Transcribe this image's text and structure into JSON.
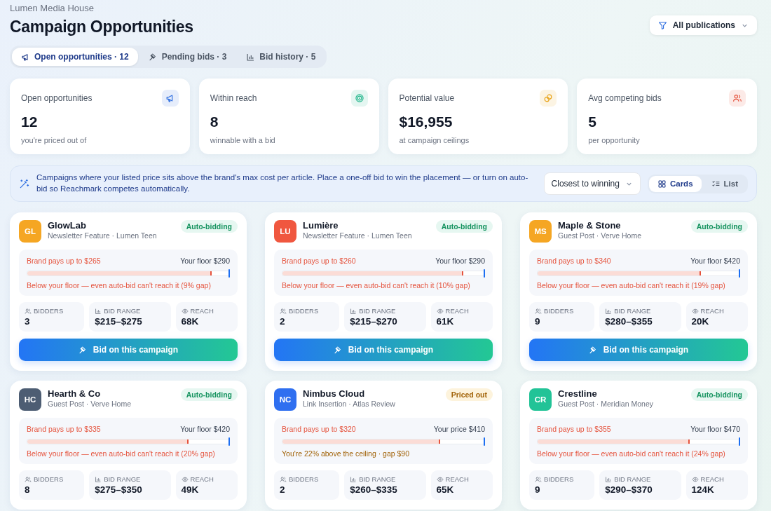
{
  "org": "Lumen Media House",
  "title": "Campaign Opportunities",
  "filter": {
    "label": "All publications"
  },
  "tabs": [
    {
      "label": "Open opportunities · 12",
      "kind": "megaphone",
      "selected": true
    },
    {
      "label": "Pending bids · 3",
      "kind": "gavel",
      "selected": false
    },
    {
      "label": "Bid history · 5",
      "kind": "chart",
      "selected": false
    }
  ],
  "stats": [
    {
      "label": "Open opportunities",
      "value": "12",
      "note": "you're priced out of",
      "kind": "megaphone",
      "color": "#2f6fe0"
    },
    {
      "label": "Within reach",
      "value": "8",
      "note": "winnable with a bid",
      "kind": "target",
      "color": "#1fb58a"
    },
    {
      "label": "Potential value",
      "value": "$16,955",
      "note": "at campaign ceilings",
      "kind": "coins",
      "color": "#e8a317"
    },
    {
      "label": "Avg competing bids",
      "value": "5",
      "note": "per opportunity",
      "kind": "users",
      "color": "#e5533d"
    }
  ],
  "banner": {
    "text": "Campaigns where your listed price sits above the brand's max cost per article. Place a one-off bid to win the placement — or turn on auto-bid so Reachmark competes automatically.",
    "sort": "Closest to winning",
    "views": [
      {
        "label": "Cards",
        "kind": "grid",
        "selected": true
      },
      {
        "label": "List",
        "kind": "list",
        "selected": false
      }
    ]
  },
  "campaigns": [
    {
      "initials": "GL",
      "color": "#f5a623",
      "name": "GlowLab",
      "sub": "Newsletter Feature · Lumen Teen",
      "status": {
        "kind": "auto",
        "label": "Auto-bidding"
      },
      "brand": "Brand pays up to $265",
      "floor": "Your floor $290",
      "level": 0.914,
      "note": "Below your floor — even auto-bid can't reach it (9% gap)",
      "metrics": [
        {
          "kind": "bidders",
          "label": "BIDDERS",
          "value": "3"
        },
        {
          "kind": "range",
          "label": "BID RANGE",
          "value": "$215–$275"
        },
        {
          "kind": "reach",
          "label": "REACH",
          "value": "68K"
        }
      ],
      "button": "Bid on this campaign"
    },
    {
      "initials": "LU",
      "color": "#f0573f",
      "name": "Lumière",
      "sub": "Newsletter Feature · Lumen Teen",
      "status": {
        "kind": "auto",
        "label": "Auto-bidding"
      },
      "brand": "Brand pays up to $260",
      "floor": "Your floor $290",
      "level": 0.897,
      "note": "Below your floor — even auto-bid can't reach it (10% gap)",
      "metrics": [
        {
          "kind": "bidders",
          "label": "BIDDERS",
          "value": "2"
        },
        {
          "kind": "range",
          "label": "BID RANGE",
          "value": "$215–$270"
        },
        {
          "kind": "reach",
          "label": "REACH",
          "value": "61K"
        }
      ],
      "button": "Bid on this campaign"
    },
    {
      "initials": "MS",
      "color": "#f5a623",
      "name": "Maple & Stone",
      "sub": "Guest Post · Verve Home",
      "status": {
        "kind": "auto",
        "label": "Auto-bidding"
      },
      "brand": "Brand pays up to $340",
      "floor": "Your floor $420",
      "level": 0.81,
      "note": "Below your floor — even auto-bid can't reach it (19% gap)",
      "metrics": [
        {
          "kind": "bidders",
          "label": "BIDDERS",
          "value": "9"
        },
        {
          "kind": "range",
          "label": "BID RANGE",
          "value": "$280–$355"
        },
        {
          "kind": "reach",
          "label": "REACH",
          "value": "20K"
        }
      ],
      "button": "Bid on this campaign"
    },
    {
      "initials": "HC",
      "color": "#4d5d73",
      "name": "Hearth & Co",
      "sub": "Guest Post · Verve Home",
      "status": {
        "kind": "auto",
        "label": "Auto-bidding"
      },
      "brand": "Brand pays up to $335",
      "floor": "Your floor $420",
      "level": 0.798,
      "note": "Below your floor — even auto-bid can't reach it (20% gap)",
      "metrics": [
        {
          "kind": "bidders",
          "label": "BIDDERS",
          "value": "8"
        },
        {
          "kind": "range",
          "label": "BID RANGE",
          "value": "$275–$350"
        },
        {
          "kind": "reach",
          "label": "REACH",
          "value": "49K"
        }
      ]
    },
    {
      "initials": "NC",
      "color": "#2f6ff0",
      "name": "Nimbus Cloud",
      "sub": "Link Insertion · Atlas Review",
      "status": {
        "kind": "priced_out",
        "label": "Priced out"
      },
      "brand": "Brand pays up to $320",
      "floor": "Your price $410",
      "level": 0.78,
      "note": "You're 22% above the ceiling · gap $90",
      "metrics": [
        {
          "kind": "bidders",
          "label": "BIDDERS",
          "value": "2"
        },
        {
          "kind": "range",
          "label": "BID RANGE",
          "value": "$260–$335"
        },
        {
          "kind": "reach",
          "label": "REACH",
          "value": "65K"
        }
      ]
    },
    {
      "initials": "CR",
      "color": "#22c397",
      "name": "Crestline",
      "sub": "Guest Post · Meridian Money",
      "status": {
        "kind": "auto",
        "label": "Auto-bidding"
      },
      "brand": "Brand pays up to $355",
      "floor": "Your floor $470",
      "level": 0.755,
      "note": "Below your floor — even auto-bid can't reach it (24% gap)",
      "metrics": [
        {
          "kind": "bidders",
          "label": "BIDDERS",
          "value": "9"
        },
        {
          "kind": "range",
          "label": "BID RANGE",
          "value": "$290–$370"
        },
        {
          "kind": "reach",
          "label": "REACH",
          "value": "124K"
        }
      ]
    }
  ]
}
